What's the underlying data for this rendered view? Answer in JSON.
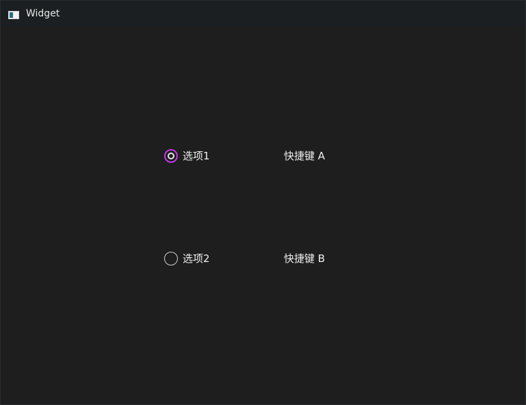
{
  "window": {
    "title": "Widget",
    "icon": "app-window-icon"
  },
  "colors": {
    "background": "#1e1e1e",
    "titlebar": "#1b1f22",
    "accent": "#c23ae6",
    "text": "#f0f0f0"
  },
  "radios": [
    {
      "label": "选项1",
      "checked": true
    },
    {
      "label": "选项2",
      "checked": false
    }
  ],
  "shortcuts": [
    {
      "label": "快捷键 A"
    },
    {
      "label": "快捷键 B"
    }
  ]
}
